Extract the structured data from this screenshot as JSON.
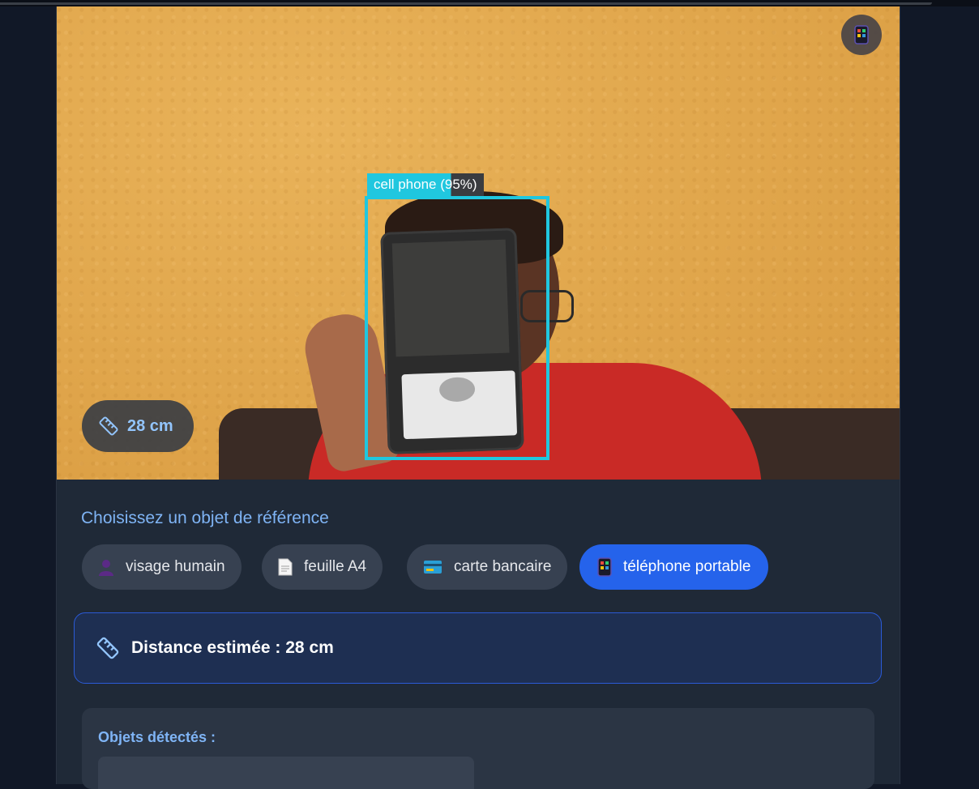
{
  "video": {
    "detection_label": "cell phone (95%)",
    "distance_pill": "28 cm",
    "corner_icon": "mobile-phone-icon"
  },
  "reference": {
    "title": "Choisissez un objet de référence",
    "options": [
      {
        "label": "visage humain",
        "icon": "person-silhouette-icon",
        "active": false
      },
      {
        "label": "feuille A4",
        "icon": "document-icon",
        "active": false
      },
      {
        "label": "carte bancaire",
        "icon": "credit-card-icon",
        "active": false
      },
      {
        "label": "téléphone portable",
        "icon": "mobile-phone-icon",
        "active": true
      }
    ]
  },
  "result": {
    "text": "Distance estimée : 28 cm",
    "icon": "ruler-icon"
  },
  "detected": {
    "title": "Objets détectés :"
  },
  "colors": {
    "accent": "#2563eb",
    "bbox": "#20c7df",
    "card_bg": "#1f2937",
    "page_bg": "#111827",
    "title_blue": "#7fb4f5"
  }
}
